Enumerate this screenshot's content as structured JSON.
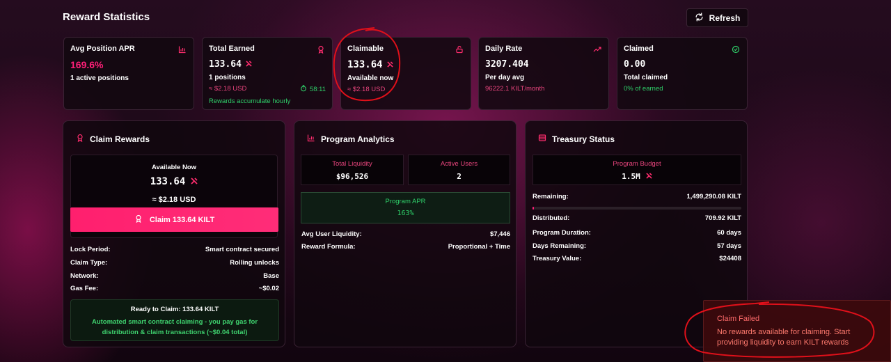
{
  "header": {
    "title": "Reward Statistics",
    "refresh_label": "Refresh"
  },
  "stats": [
    {
      "label": "Avg Position APR",
      "value": "169.6%",
      "line1": "1 active positions"
    },
    {
      "label": "Total Earned",
      "value": "133.64",
      "line1": "1 positions",
      "line2": "≈ $2.18 USD",
      "timer": "58:11",
      "line3": "Rewards accumulate hourly"
    },
    {
      "label": "Claimable",
      "value": "133.64",
      "line1": "Available now",
      "line2": "≈ $2.18 USD"
    },
    {
      "label": "Daily Rate",
      "value": "3207.404",
      "line1": "Per day avg",
      "line2": "96222.1 KILT/month"
    },
    {
      "label": "Claimed",
      "value": "0.00",
      "line1": "Total claimed",
      "line2": "0% of earned"
    }
  ],
  "claim": {
    "title": "Claim Rewards",
    "available_label": "Available Now",
    "amount": "133.64",
    "usd": "≈ $2.18 USD",
    "button": "Claim 133.64 KILT",
    "details": [
      {
        "k": "Lock Period:",
        "v": "Smart contract secured"
      },
      {
        "k": "Claim Type:",
        "v": "Rolling unlocks"
      },
      {
        "k": "Network:",
        "v": "Base"
      },
      {
        "k": "Gas Fee:",
        "v": "~$0.02"
      }
    ],
    "ready_title": "Ready to Claim: 133.64 KILT",
    "ready_text1": "Automated smart contract claiming - you pay gas for",
    "ready_text2": "distribution & claim transactions (~$0.04 total)"
  },
  "analytics": {
    "title": "Program Analytics",
    "total_liquidity_label": "Total Liquidity",
    "total_liquidity": "$96,526",
    "active_users_label": "Active Users",
    "active_users": "2",
    "apr_label": "Program APR",
    "apr": "163%",
    "rows": [
      {
        "k": "Avg User Liquidity:",
        "v": "$7,446"
      },
      {
        "k": "Reward Formula:",
        "v": "Proportional + Time"
      }
    ]
  },
  "treasury": {
    "title": "Treasury Status",
    "budget_label": "Program Budget",
    "budget": "1.5M",
    "remaining_label": "Remaining:",
    "remaining": "1,499,290.08 KILT",
    "distributed_fraction": 0.0005,
    "rows": [
      {
        "k": "Distributed:",
        "v": "709.92 KILT"
      },
      {
        "k": "Program Duration:",
        "v": "60 days"
      },
      {
        "k": "Days Remaining:",
        "v": "57 days"
      },
      {
        "k": "Treasury Value:",
        "v": "$24408"
      }
    ]
  },
  "toast": {
    "title": "Claim Failed",
    "line1": "No rewards available for claiming. Start",
    "line2": "providing liquidity to earn KILT rewards"
  },
  "colors": {
    "accent": "#ff1f78",
    "success": "#2fd06a",
    "annotation": "#e0101a"
  }
}
